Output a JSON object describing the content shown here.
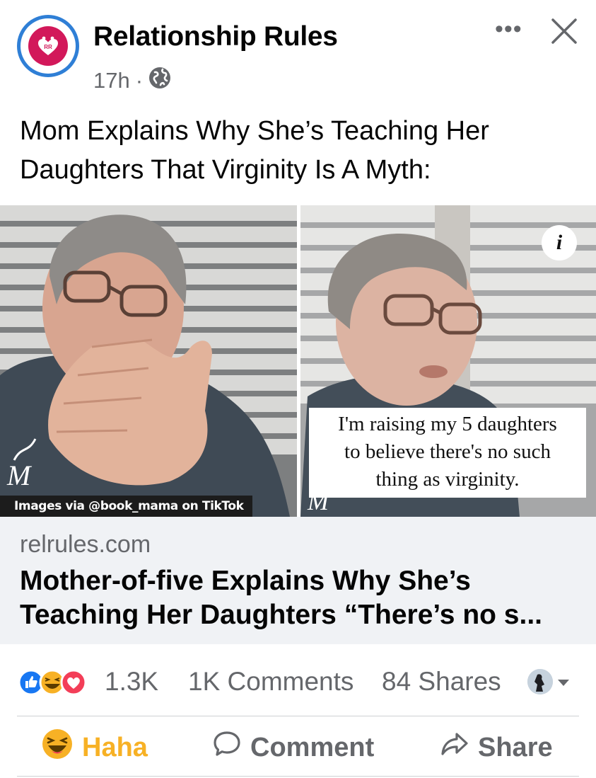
{
  "post": {
    "page_name": "Relationship Rules",
    "time": "17h",
    "separator": "·",
    "privacy_icon": "globe-icon",
    "more_label": "•••",
    "close_icon": "close-icon",
    "text": "Mom Explains Why She’s Teaching Her Daughters That Virginity Is A Myth:"
  },
  "media": {
    "credit": "Images via @book_mama on TikTok",
    "quote_line1": "I'm raising my 5 daughters",
    "quote_line2": "to believe there's no such",
    "quote_line3": "thing as virginity.",
    "info_label": "i",
    "watermark": "M"
  },
  "link": {
    "domain": "relrules.com",
    "title": "Mother-of-five Explains Why She’s Teaching Her Daughters “There’s no s..."
  },
  "stats": {
    "reaction_icons": [
      "like-icon",
      "haha-icon",
      "love-icon"
    ],
    "reaction_count": "1.3K",
    "comments": "1K Comments",
    "shares": "84 Shares"
  },
  "actions": {
    "haha": "Haha",
    "comment": "Comment",
    "share": "Share"
  },
  "colors": {
    "brand_blue": "#1877f2",
    "haha_yellow": "#f7b125",
    "love_red": "#f33e58",
    "secondary_text": "#65676b"
  }
}
